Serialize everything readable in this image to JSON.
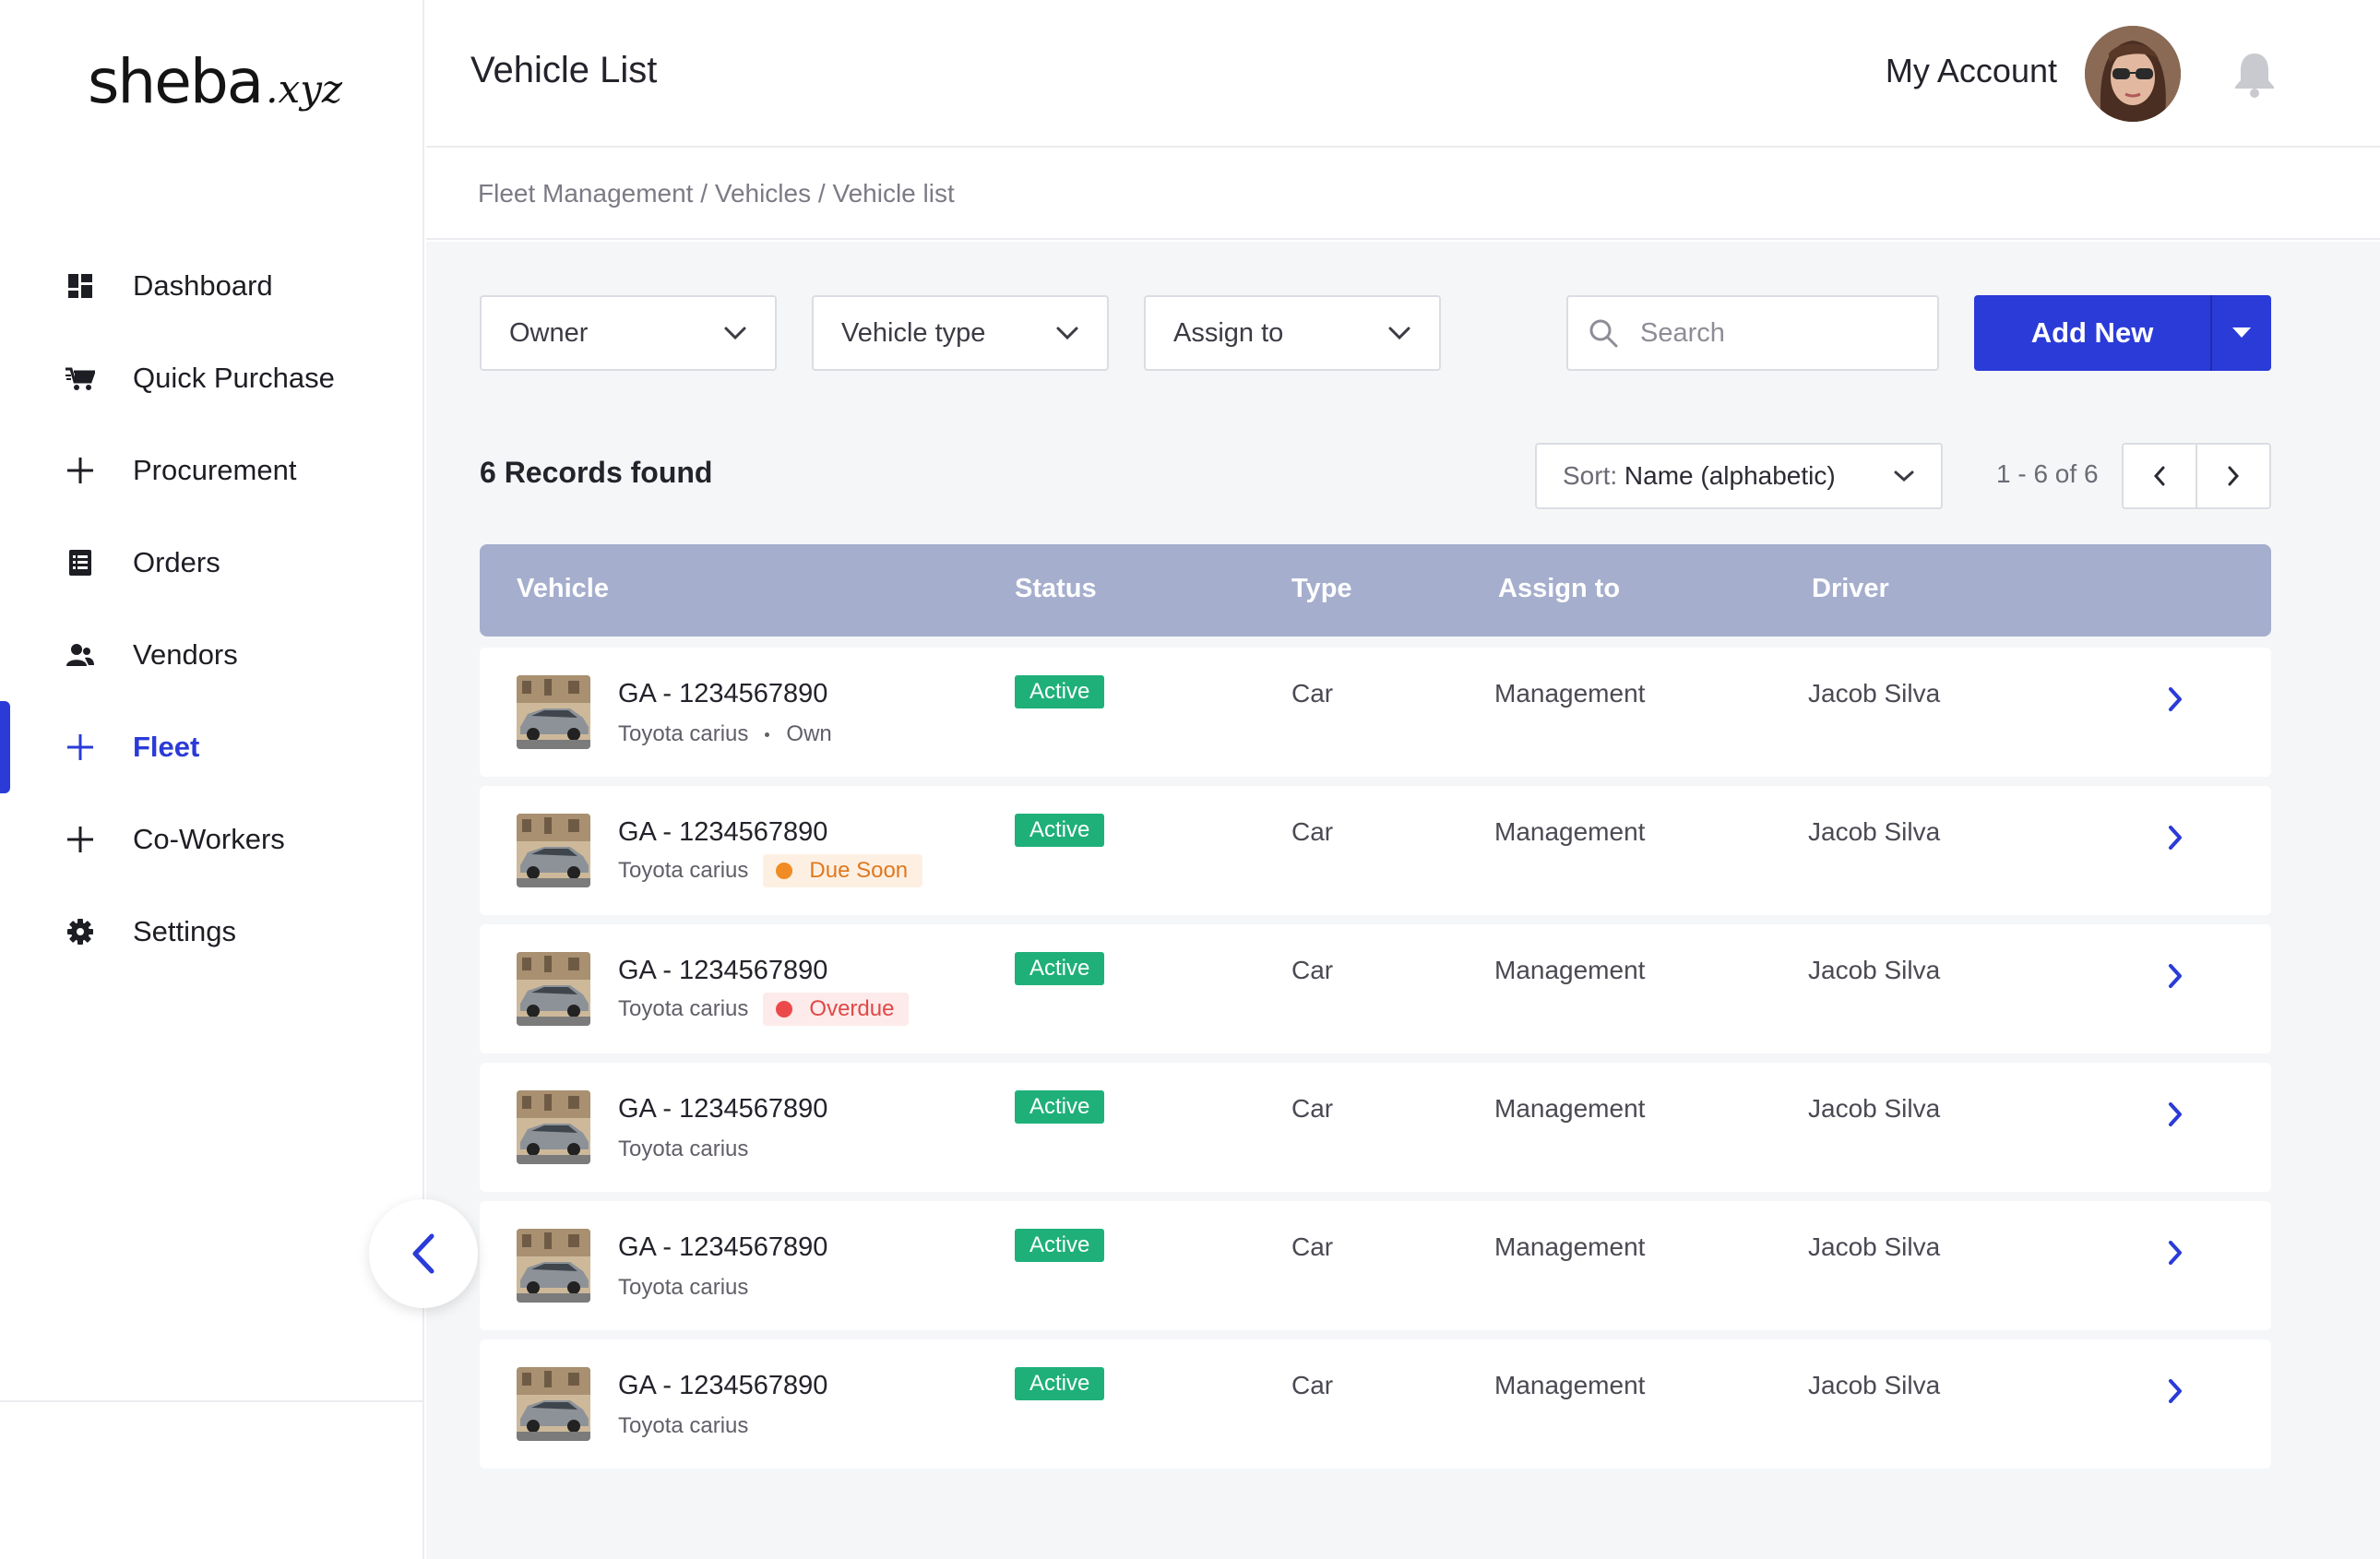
{
  "brand": {
    "main": "sheba",
    "sub": ".xyz"
  },
  "sidebar": {
    "items": [
      {
        "label": "Dashboard",
        "icon": "dashboard-icon"
      },
      {
        "label": "Quick Purchase",
        "icon": "cart-icon"
      },
      {
        "label": "Procurement",
        "icon": "plus-icon"
      },
      {
        "label": "Orders",
        "icon": "list-icon"
      },
      {
        "label": "Vendors",
        "icon": "vendors-icon"
      },
      {
        "label": "Fleet",
        "icon": "plus-icon",
        "active": true
      },
      {
        "label": "Co-Workers",
        "icon": "plus-icon"
      },
      {
        "label": "Settings",
        "icon": "gear-icon"
      }
    ]
  },
  "header": {
    "title": "Vehicle List",
    "account_label": "My Account"
  },
  "breadcrumb": [
    "Fleet Management",
    "Vehicles",
    "Vehicle list"
  ],
  "filters": {
    "owner": "Owner",
    "vehicle_type": "Vehicle type",
    "assign_to": "Assign to"
  },
  "search": {
    "placeholder": "Search"
  },
  "add_button": {
    "label": "Add New"
  },
  "records": {
    "summary": "6 Records found"
  },
  "sort": {
    "prefix": "Sort:",
    "value": "Name (alphabetic)"
  },
  "pagination": {
    "text": "1 - 6 of 6"
  },
  "table": {
    "columns": [
      "Vehicle",
      "Status",
      "Type",
      "Assign to",
      "Driver"
    ],
    "rows": [
      {
        "vehicle_id": "GA - 1234567890",
        "model": "Toyota carius",
        "ownership": "Own",
        "status": "Active",
        "type": "Car",
        "assign_to": "Management",
        "driver": "Jacob Silva"
      },
      {
        "vehicle_id": "GA - 1234567890",
        "model": "Toyota carius",
        "tag": "Due Soon",
        "status": "Active",
        "type": "Car",
        "assign_to": "Management",
        "driver": "Jacob Silva"
      },
      {
        "vehicle_id": "GA - 1234567890",
        "model": "Toyota carius",
        "tag": "Overdue",
        "status": "Active",
        "type": "Car",
        "assign_to": "Management",
        "driver": "Jacob Silva"
      },
      {
        "vehicle_id": "GA - 1234567890",
        "model": "Toyota carius",
        "status": "Active",
        "type": "Car",
        "assign_to": "Management",
        "driver": "Jacob Silva"
      },
      {
        "vehicle_id": "GA - 1234567890",
        "model": "Toyota carius",
        "status": "Active",
        "type": "Car",
        "assign_to": "Management",
        "driver": "Jacob Silva"
      },
      {
        "vehicle_id": "GA - 1234567890",
        "model": "Toyota carius",
        "status": "Active",
        "type": "Car",
        "assign_to": "Management",
        "driver": "Jacob Silva"
      }
    ]
  },
  "colors": {
    "accent": "#2a3bd8",
    "status_active": "#1fb07a",
    "due_soon": "#f08c23",
    "overdue": "#ec4a4a",
    "table_header": "#a5aecd"
  }
}
